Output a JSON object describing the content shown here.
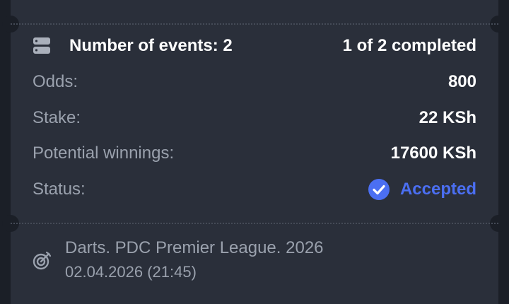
{
  "summary": {
    "events_label": "Number of events: 2",
    "progress": "1 of 2 completed"
  },
  "details": [
    {
      "label": "Odds:",
      "value": "800"
    },
    {
      "label": "Stake:",
      "value": "22 KSh"
    },
    {
      "label": "Potential winnings:",
      "value": "17600 KSh"
    }
  ],
  "status": {
    "label": "Status:",
    "value": "Accepted",
    "color": "#4b6ff2"
  },
  "event": {
    "name": "Darts. PDC Premier League. 2026",
    "datetime": "02.04.2026 (21:45)",
    "icon": "dart-target-icon"
  }
}
